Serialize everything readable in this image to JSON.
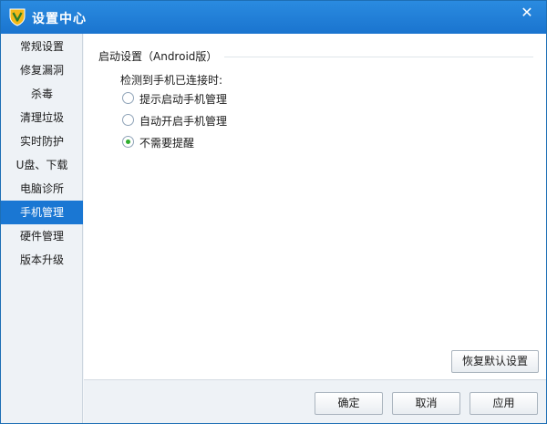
{
  "window": {
    "title": "设置中心",
    "close_glyph": "✕"
  },
  "sidebar": {
    "items": [
      {
        "label": "常规设置",
        "active": false
      },
      {
        "label": "修复漏洞",
        "active": false
      },
      {
        "label": "杀毒",
        "active": false
      },
      {
        "label": "清理垃圾",
        "active": false
      },
      {
        "label": "实时防护",
        "active": false
      },
      {
        "label": "U盘、下载",
        "active": false
      },
      {
        "label": "电脑诊所",
        "active": false
      },
      {
        "label": "手机管理",
        "active": true
      },
      {
        "label": "硬件管理",
        "active": false
      },
      {
        "label": "版本升级",
        "active": false
      }
    ]
  },
  "main": {
    "section_title": "启动设置（Android版）",
    "prompt": "检测到手机已连接时:",
    "options": [
      {
        "label": "提示启动手机管理",
        "checked": false
      },
      {
        "label": "自动开启手机管理",
        "checked": false
      },
      {
        "label": "不需要提醒",
        "checked": true
      }
    ],
    "restore_defaults_label": "恢复默认设置"
  },
  "footer": {
    "ok_label": "确定",
    "cancel_label": "取消",
    "apply_label": "应用"
  },
  "colors": {
    "titlebar": "#1a74cf",
    "active_nav": "#1a77d3",
    "radio_checked": "#2fae2f"
  },
  "icons": {
    "logo": "shield-v-logo",
    "close": "close-icon"
  }
}
